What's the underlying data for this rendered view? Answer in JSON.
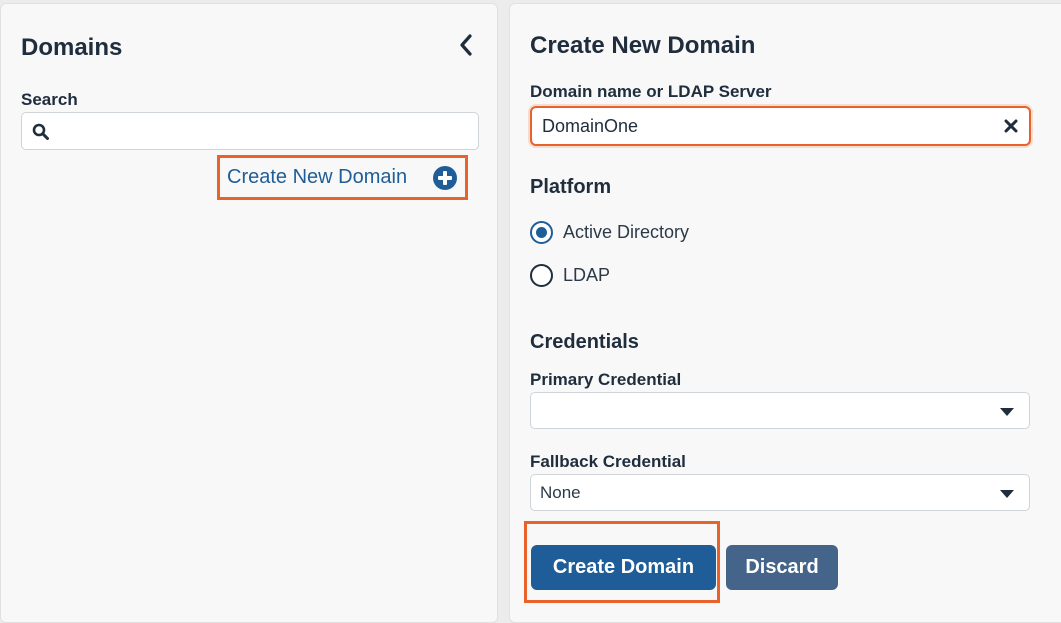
{
  "left_panel": {
    "title": "Domains",
    "search_label": "Search",
    "search_placeholder": "",
    "create_link_label": "Create New Domain"
  },
  "form": {
    "title": "Create New Domain",
    "domain_label": "Domain name or LDAP Server",
    "domain_value": "DomainOne",
    "platform_title": "Platform",
    "platform_options": [
      {
        "label": "Active Directory",
        "selected": true
      },
      {
        "label": "LDAP",
        "selected": false
      }
    ],
    "credentials_title": "Credentials",
    "primary_label": "Primary Credential",
    "primary_value": "",
    "fallback_label": "Fallback Credential",
    "fallback_value": "None",
    "create_button": "Create Domain",
    "discard_button": "Discard"
  },
  "colors": {
    "accent": "#1f5d98",
    "secondary_button": "#45648a",
    "highlight": "#e8632a"
  },
  "icons": [
    "chevron-left-icon",
    "search-icon",
    "plus-circle-icon",
    "clear-icon",
    "caret-down-icon"
  ]
}
